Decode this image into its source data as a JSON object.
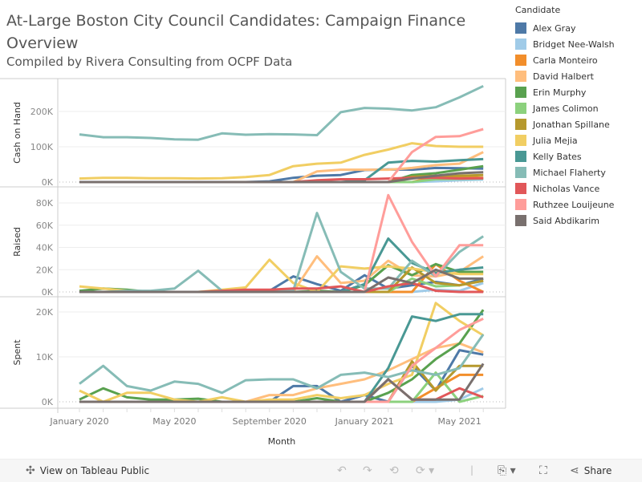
{
  "title": "At-Large Boston City Council Candidates: Campaign Finance Overview",
  "subtitle": "Compiled by Rivera Consulting from OCPF Data",
  "legend": {
    "title": "Candidate"
  },
  "footer": {
    "view_label": "View on Tableau Public",
    "share_label": "Share",
    "icons": [
      "tableau-logo-icon",
      "undo-icon",
      "redo-icon",
      "revert-icon",
      "refresh-icon",
      "download-icon",
      "fullscreen-icon",
      "share-icon"
    ]
  },
  "chart_data": {
    "type": "line",
    "xlabel": "Month",
    "x": [
      "Jan 2020",
      "Feb 2020",
      "Mar 2020",
      "Apr 2020",
      "May 2020",
      "Jun 2020",
      "Jul 2020",
      "Aug 2020",
      "Sep 2020",
      "Oct 2020",
      "Nov 2020",
      "Dec 2020",
      "Jan 2021",
      "Feb 2021",
      "Mar 2021",
      "Apr 2021",
      "May 2021",
      "Jun 2021"
    ],
    "x_tick_labels": [
      "January 2020",
      "May 2020",
      "September 2020",
      "January 2021",
      "May 2021"
    ],
    "x_tick_index": [
      0,
      4,
      8,
      12,
      16
    ],
    "grid": true,
    "legend_position": "right",
    "panels": [
      {
        "name": "Cash on Hand",
        "ylim": [
          0,
          280000
        ],
        "ticks": [
          0,
          100000,
          200000
        ],
        "tick_labels": [
          "0K",
          "100K",
          "200K"
        ]
      },
      {
        "name": "Raised",
        "ylim": [
          0,
          90000
        ],
        "ticks": [
          0,
          20000,
          40000,
          60000,
          80000
        ],
        "tick_labels": [
          "0K",
          "20K",
          "40K",
          "60K",
          "80K"
        ]
      },
      {
        "name": "Spent",
        "ylim": [
          0,
          22000
        ],
        "ticks": [
          0,
          10000,
          20000
        ],
        "tick_labels": [
          "0K",
          "10K",
          "20K"
        ]
      }
    ],
    "series": [
      {
        "name": "Alex Gray",
        "color": "#4e79a7",
        "cash": [
          0,
          0,
          0,
          0,
          0,
          0,
          0,
          0,
          2000,
          12000,
          18000,
          20000,
          34000,
          36000,
          35000,
          40000,
          39000,
          38000
        ],
        "raised": [
          0,
          0,
          0,
          0,
          0,
          0,
          0,
          0,
          1000,
          14000,
          7000,
          1000,
          15000,
          3000,
          6000,
          9000,
          6000,
          12000
        ],
        "spent": [
          0,
          0,
          0,
          0,
          0,
          0,
          0,
          0,
          0,
          3500,
          3500,
          0,
          1500,
          0,
          8000,
          2500,
          11500,
          10500
        ]
      },
      {
        "name": "Bridget Nee-Walsh",
        "color": "#a0cbe8",
        "cash": [
          0,
          0,
          0,
          0,
          0,
          0,
          0,
          0,
          0,
          0,
          0,
          0,
          0,
          0,
          0,
          2000,
          5000,
          7000
        ],
        "raised": [
          0,
          0,
          0,
          0,
          0,
          0,
          0,
          0,
          0,
          0,
          0,
          0,
          0,
          0,
          0,
          2000,
          1000,
          8000
        ],
        "spent": [
          0,
          0,
          0,
          0,
          0,
          0,
          0,
          0,
          0,
          0,
          0,
          0,
          0,
          0,
          0,
          0,
          500,
          3000
        ]
      },
      {
        "name": "Carla Monteiro",
        "color": "#f28e2b",
        "cash": [
          0,
          0,
          0,
          0,
          0,
          0,
          0,
          0,
          0,
          0,
          0,
          0,
          0,
          0,
          0,
          15000,
          14000,
          12000
        ],
        "raised": [
          0,
          0,
          0,
          0,
          0,
          0,
          0,
          0,
          0,
          0,
          0,
          0,
          0,
          0,
          0,
          25000,
          10000,
          0
        ],
        "spent": [
          0,
          0,
          0,
          0,
          0,
          0,
          0,
          0,
          0,
          0,
          0,
          0,
          0,
          0,
          0,
          3000,
          6000,
          6000
        ]
      },
      {
        "name": "David Halbert",
        "color": "#ffbe7d",
        "cash": [
          0,
          0,
          0,
          0,
          0,
          0,
          0,
          0,
          0,
          0,
          30000,
          35000,
          35000,
          35000,
          40000,
          48000,
          52000,
          85000
        ],
        "raised": [
          0,
          0,
          0,
          0,
          0,
          0,
          0,
          0,
          0,
          0,
          32000,
          8000,
          10000,
          28000,
          15000,
          14000,
          18000,
          32000
        ],
        "spent": [
          0,
          0,
          0,
          0,
          0,
          0,
          0,
          0,
          1500,
          1500,
          3000,
          4000,
          5000,
          7000,
          9500,
          12000,
          13000,
          11000
        ]
      },
      {
        "name": "Erin Murphy",
        "color": "#59a14f",
        "cash": [
          0,
          0,
          0,
          0,
          0,
          0,
          0,
          0,
          0,
          0,
          0,
          0,
          0,
          0,
          20000,
          25000,
          35000,
          45000
        ],
        "raised": [
          1000,
          3000,
          2000,
          0,
          0,
          0,
          0,
          0,
          0,
          0,
          1000,
          0,
          6000,
          24000,
          15000,
          25000,
          18000,
          18000
        ],
        "spent": [
          500,
          3000,
          1000,
          500,
          500,
          700,
          0,
          0,
          0,
          0,
          800,
          0,
          0,
          2000,
          5000,
          9500,
          13000,
          20500
        ]
      },
      {
        "name": "James Colimon",
        "color": "#8cd17d",
        "cash": [
          0,
          0,
          0,
          0,
          0,
          0,
          0,
          0,
          0,
          0,
          0,
          0,
          0,
          0,
          0,
          8000,
          9000,
          10000
        ],
        "raised": [
          0,
          0,
          0,
          0,
          0,
          0,
          0,
          0,
          0,
          0,
          0,
          0,
          0,
          0,
          12000,
          5000,
          6000,
          10000
        ],
        "spent": [
          0,
          0,
          0,
          0,
          0,
          0,
          0,
          0,
          0,
          0,
          0,
          0,
          0,
          0,
          0,
          6500,
          0,
          1300
        ]
      },
      {
        "name": "Jonathan Spillane",
        "color": "#b6992d",
        "cash": [
          0,
          0,
          0,
          0,
          0,
          0,
          0,
          0,
          0,
          0,
          0,
          0,
          0,
          0,
          15000,
          18000,
          18000,
          20000
        ],
        "raised": [
          0,
          0,
          0,
          0,
          0,
          0,
          0,
          0,
          0,
          0,
          0,
          0,
          0,
          0,
          22000,
          8000,
          6000,
          10000
        ],
        "spent": [
          0,
          0,
          0,
          0,
          0,
          0,
          0,
          0,
          0,
          0,
          0,
          0,
          0,
          0,
          9000,
          2500,
          8000,
          8000
        ]
      },
      {
        "name": "Julia Mejia",
        "color": "#f1ce63",
        "cash": [
          10000,
          12000,
          12000,
          11000,
          11000,
          10000,
          11000,
          14000,
          20000,
          45000,
          52000,
          55000,
          77000,
          92000,
          110000,
          102000,
          100000,
          100000
        ],
        "raised": [
          5000,
          3000,
          1000,
          0,
          0,
          0,
          2000,
          4000,
          29000,
          8000,
          0,
          23000,
          21000,
          23000,
          21000,
          18000,
          16000,
          16000
        ],
        "spent": [
          2500,
          0,
          2000,
          2000,
          500,
          0,
          1000,
          0,
          500,
          500,
          1500,
          800,
          1500,
          4000,
          6000,
          22000,
          18000,
          14800
        ]
      },
      {
        "name": "Kelly Bates",
        "color": "#499894",
        "cash": [
          0,
          0,
          0,
          0,
          0,
          0,
          0,
          0,
          0,
          0,
          0,
          0,
          5000,
          55000,
          60000,
          58000,
          62000,
          65000
        ],
        "raised": [
          0,
          0,
          0,
          0,
          0,
          0,
          0,
          0,
          0,
          0,
          0,
          0,
          7000,
          48000,
          26000,
          17000,
          20000,
          22000
        ],
        "spent": [
          0,
          0,
          0,
          0,
          0,
          0,
          0,
          0,
          0,
          0,
          0,
          0,
          0,
          7500,
          19000,
          18000,
          19500,
          19500
        ]
      },
      {
        "name": "Michael Flaherty",
        "color": "#86bcb6",
        "cash": [
          135000,
          127000,
          127000,
          125000,
          121000,
          120000,
          138000,
          134000,
          136000,
          135000,
          133000,
          198000,
          210000,
          208000,
          203000,
          212000,
          240000,
          272000
        ],
        "raised": [
          0,
          0,
          1000,
          1000,
          3000,
          19000,
          1000,
          1000,
          1000,
          1000,
          71000,
          18000,
          3000,
          3000,
          28000,
          14000,
          36000,
          50000
        ],
        "spent": [
          4000,
          8000,
          3500,
          2500,
          4500,
          4000,
          2000,
          4800,
          5000,
          5000,
          3000,
          6000,
          6500,
          5500,
          7000,
          6000,
          7500,
          15000
        ]
      },
      {
        "name": "Nicholas Vance",
        "color": "#e15759",
        "cash": [
          0,
          0,
          0,
          0,
          0,
          0,
          0,
          0,
          0,
          0,
          5000,
          8000,
          8000,
          10000,
          12000,
          12000,
          10000,
          11000
        ],
        "raised": [
          0,
          0,
          0,
          0,
          0,
          0,
          1000,
          2000,
          2000,
          3000,
          3000,
          5000,
          0,
          5000,
          8000,
          1000,
          0,
          0
        ],
        "spent": [
          0,
          0,
          0,
          0,
          0,
          0,
          0,
          0,
          0,
          0,
          0,
          0,
          0,
          5000,
          500,
          500,
          3000,
          1000
        ]
      },
      {
        "name": "Ruthzee Louijeune",
        "color": "#ff9d9a",
        "cash": [
          0,
          0,
          0,
          0,
          0,
          0,
          0,
          0,
          0,
          0,
          0,
          0,
          0,
          0,
          85000,
          128000,
          130000,
          150000
        ],
        "raised": [
          0,
          0,
          0,
          0,
          0,
          0,
          0,
          0,
          0,
          0,
          0,
          0,
          0,
          87000,
          45000,
          14000,
          42000,
          42000
        ],
        "spent": [
          0,
          0,
          0,
          0,
          0,
          0,
          0,
          0,
          0,
          0,
          0,
          0,
          0,
          0,
          8000,
          12000,
          16000,
          18500
        ]
      },
      {
        "name": "Said Abdikarim",
        "color": "#79706e",
        "cash": [
          0,
          0,
          0,
          0,
          0,
          0,
          0,
          0,
          0,
          0,
          0,
          0,
          0,
          0,
          10000,
          18000,
          25000,
          28000
        ],
        "raised": [
          0,
          0,
          0,
          0,
          0,
          0,
          0,
          0,
          0,
          0,
          0,
          0,
          0,
          13000,
          8000,
          20000,
          12000,
          12000
        ],
        "spent": [
          0,
          0,
          0,
          0,
          0,
          0,
          0,
          0,
          0,
          0,
          0,
          0,
          0,
          5000,
          500,
          500,
          500,
          8500
        ]
      }
    ]
  }
}
